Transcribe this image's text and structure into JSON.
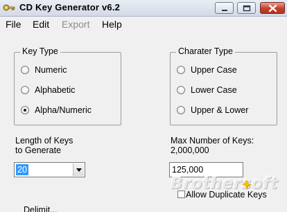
{
  "window": {
    "title": "CD Key Generator v6.2"
  },
  "menu": {
    "items": [
      "File",
      "Edit",
      "Export",
      "Help"
    ]
  },
  "key_type": {
    "legend": "Key Type",
    "options": [
      "Numeric",
      "Alphabetic",
      "Alpha/Numeric"
    ],
    "selected_index": 2
  },
  "char_type": {
    "legend": "Charater Type",
    "options": [
      "Upper Case",
      "Lower Case",
      "Upper & Lower"
    ],
    "selected_index": -1
  },
  "length": {
    "label_line1": "Length of Keys",
    "label_line2": "to Generate",
    "value": "20"
  },
  "max_keys": {
    "label_line1": "Max Number of Keys:",
    "label_line2": "2,000,000",
    "value": "125,000"
  },
  "allow_duplicates": {
    "label": "Allow Duplicate Keys",
    "checked": false
  },
  "partial_label": "Delimit...",
  "watermark": {
    "text": "Brothersoft"
  },
  "colors": {
    "title_close": "#c0412c",
    "selection": "#3399ff"
  }
}
